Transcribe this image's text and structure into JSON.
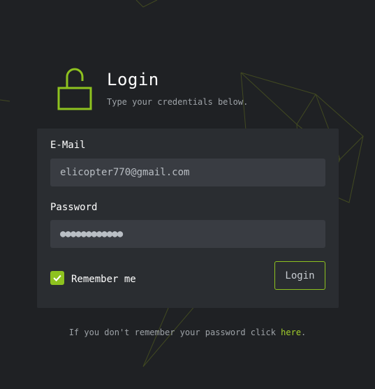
{
  "header": {
    "title": "Login",
    "subtitle": "Type your credentials below.",
    "icon": "unlocked-padlock-icon"
  },
  "form": {
    "email": {
      "label": "E-Mail",
      "value": "elicopter770@gmail.com"
    },
    "password": {
      "label": "Password",
      "value": "●●●●●●●●●●●●"
    },
    "remember": {
      "label": "Remember me",
      "checked": true
    },
    "submit_label": "Login"
  },
  "footer": {
    "text_before": "If you don't remember your password click ",
    "link_text": "here",
    "text_after": "."
  },
  "colors": {
    "background": "#1f2124",
    "card": "#2a2d31",
    "input": "#393c42",
    "accent": "#8ec21f"
  }
}
